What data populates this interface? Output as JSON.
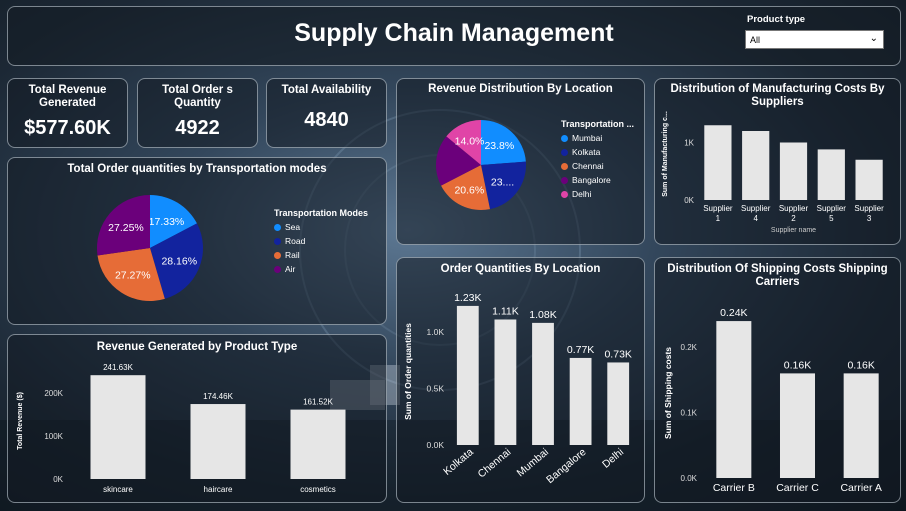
{
  "header": {
    "title": "Supply Chain Management",
    "filter_label": "Product type",
    "filter_value": "All"
  },
  "kpis": [
    {
      "label": "Total Revenue Generated",
      "value": "$577.60K"
    },
    {
      "label": "Total Order s Quantity",
      "value": "4922"
    },
    {
      "label": "Total Availability",
      "value": "4840"
    }
  ],
  "colors": {
    "blue": "#118dff",
    "navy": "#12239e",
    "orange": "#e66c37",
    "purple": "#6b007b",
    "pink": "#e044a7",
    "bar": "#e6e6e6"
  },
  "chart_data": [
    {
      "type": "pie",
      "title": "Total Order quantities by Transportation modes",
      "legend_title": "Transportation Modes",
      "labels": [
        "Sea",
        "Road",
        "Rail",
        "Air"
      ],
      "values": [
        17.33,
        28.16,
        27.27,
        27.25
      ],
      "value_labels": [
        "17.33%",
        "28.16%",
        "27.27%",
        "27.25%"
      ],
      "colors": [
        "#118dff",
        "#12239e",
        "#e66c37",
        "#6b007b"
      ],
      "legend_position": "right"
    },
    {
      "type": "pie",
      "title": "Revenue Distribution By Location",
      "legend_title": "Transportation ...",
      "labels": [
        "Mumbai",
        "Kolkata",
        "Chennai",
        "Bangalore",
        "Delhi"
      ],
      "values": [
        23.8,
        23.0,
        20.6,
        18.6,
        14.0
      ],
      "value_labels": [
        "23.8%",
        "23....",
        "20.6%",
        "",
        "14.0%"
      ],
      "colors": [
        "#118dff",
        "#12239e",
        "#e66c37",
        "#6b007b",
        "#e044a7"
      ],
      "legend_position": "right"
    },
    {
      "type": "bar",
      "title": "Distribution of Manufacturing Costs By Suppliers",
      "categories": [
        "Supplier 1",
        "Supplier 4",
        "Supplier 2",
        "Supplier 5",
        "Supplier 3"
      ],
      "values": [
        1.3,
        1.2,
        1.0,
        0.88,
        0.7
      ],
      "ylabel": "Sum of Manufacturing c...",
      "xlabel": "Supplier name",
      "ylim": [
        0,
        1.6
      ],
      "yticks": [
        "0K",
        "1K"
      ]
    },
    {
      "type": "bar",
      "title": "Order Quantities By Location",
      "categories": [
        "Kolkata",
        "Chennai",
        "Mumbai",
        "Bangalore",
        "Delhi"
      ],
      "values": [
        1.23,
        1.11,
        1.08,
        0.77,
        0.73
      ],
      "value_labels": [
        "1.23K",
        "1.11K",
        "1.08K",
        "0.77K",
        "0.73K"
      ],
      "ylabel": "Sum of Order quantities",
      "ylim": [
        0,
        1.3
      ],
      "yticks": [
        "0.0K",
        "0.5K",
        "1.0K"
      ]
    },
    {
      "type": "bar",
      "title": "Distribution Of Shipping Costs Shipping Carriers",
      "categories": [
        "Carrier B",
        "Carrier C",
        "Carrier A"
      ],
      "values": [
        0.24,
        0.16,
        0.16
      ],
      "value_labels": [
        "0.24K",
        "0.16K",
        "0.16K"
      ],
      "ylabel": "Sum of Shipping costs",
      "ylim": [
        0,
        0.26
      ],
      "yticks": [
        "0.0K",
        "0.1K",
        "0.2K"
      ]
    },
    {
      "type": "bar",
      "title": "Revenue Generated by Product Type",
      "categories": [
        "skincare",
        "haircare",
        "cosmetics"
      ],
      "values": [
        241.63,
        174.46,
        161.52
      ],
      "value_labels": [
        "241.63K",
        "174.46K",
        "161.52K"
      ],
      "ylabel": "Total Revenue ($)",
      "ylim": [
        0,
        270
      ],
      "yticks": [
        "0K",
        "100K",
        "200K"
      ]
    }
  ]
}
